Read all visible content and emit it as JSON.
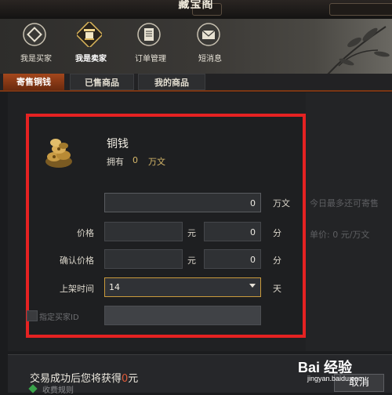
{
  "window": {
    "title": "藏宝阁"
  },
  "nav": {
    "items": [
      {
        "label": "我是买家",
        "icon": "coin-diamond-icon",
        "active": false
      },
      {
        "label": "我是卖家",
        "icon": "stall-icon",
        "active": true
      },
      {
        "label": "订单管理",
        "icon": "book-icon",
        "active": false
      },
      {
        "label": "短消息",
        "icon": "envelope-icon",
        "active": false
      }
    ]
  },
  "tabs": [
    {
      "label": "寄售铜钱",
      "active": true
    },
    {
      "label": "已售商品",
      "active": false
    },
    {
      "label": "我的商品",
      "active": false
    }
  ],
  "item": {
    "name": "铜钱",
    "owned_label": "拥有",
    "owned_value": "0",
    "owned_unit": "万文",
    "icon": "coin-pile-icon"
  },
  "form": {
    "amount_value": "0",
    "amount_unit": "万文",
    "price_label": "价格",
    "price_yuan_value": "",
    "price_yuan_unit": "元",
    "price_fen_value": "0",
    "price_fen_unit": "分",
    "confirm_label": "确认价格",
    "confirm_yuan_value": "",
    "confirm_yuan_unit": "元",
    "confirm_fen_value": "0",
    "confirm_fen_unit": "分",
    "time_label": "上架时间",
    "time_value": "14",
    "time_unit": "天",
    "buyer_label": "指定买家ID",
    "buyer_value": ""
  },
  "hints": {
    "remaining": "今日最多还可寄售",
    "unitprice_label": "单价:",
    "unitprice_value": "0",
    "unitprice_unit": "元/万文"
  },
  "bottom": {
    "gain_prefix": "交易成功后您将获得",
    "gain_value": "0",
    "gain_unit": "元",
    "sub_text": "收费规则",
    "cancel_label": "取消"
  },
  "watermark": {
    "brand": "Bai 经验",
    "url": "jingyan.baidu.com"
  },
  "colors": {
    "accent_red": "#e52222",
    "tab_active": "#a4471c",
    "gold": "#d7b86a",
    "field_border_focus": "#c99a3c"
  }
}
